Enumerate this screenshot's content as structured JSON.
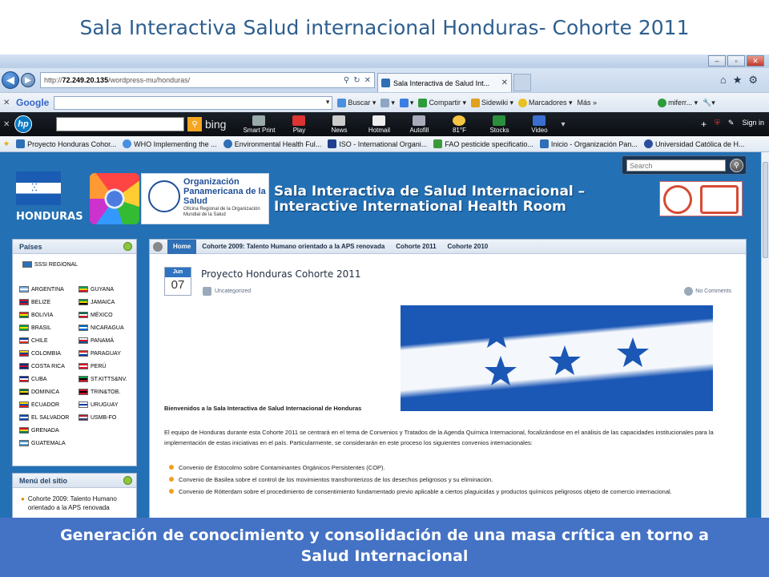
{
  "slide": {
    "title": "Sala Interactiva Salud internacional Honduras- Cohorte 2011",
    "footer_line1": "Generación de conocimiento y consolidación de una masa crítica en torno a",
    "footer_line2": "Salud Internacional"
  },
  "browser": {
    "url_prefix": "http://",
    "url_host": "72.249.20.135",
    "url_path": "/wordpress-mu/honduras/",
    "tab_title": "Sala Interactiva de Salud Int...",
    "window_buttons": [
      "–",
      "▫",
      "✕"
    ]
  },
  "google_bar": {
    "logo": "Google",
    "items": [
      "Buscar ▾",
      "Compartir ▾",
      "Sidewiki ▾",
      "Marcadores ▾",
      "Más »",
      "miferr... ▾"
    ]
  },
  "hp_bar": {
    "logo": "hp",
    "bing": "bing",
    "buttons": [
      "Smart Print",
      "Play",
      "News",
      "Hotmail",
      "Autofill",
      "81°F",
      "Stocks",
      "Video"
    ],
    "signin": "Sign in"
  },
  "favorites": [
    "Proyecto Honduras Cohor...",
    "WHO  Implementing the ...",
    "Environmental Health  Ful...",
    "ISO - International Organi...",
    "FAO pesticide specificatio...",
    "Inicio - Organización Pan...",
    "Universidad Católica de H..."
  ],
  "site": {
    "search_placeholder": "Search",
    "country_label": "HONDURAS",
    "ops_title": "Organización Panamericana de la Salud",
    "ops_sub": "Oficina Regional de la Organización Mundial de la Salud",
    "banner_line1": "Sala Interactiva de Salud Internacional –",
    "banner_line2": "Interactive International Health Room"
  },
  "sidebar": {
    "paises_title": "Países",
    "regional": "SSSI REGIONAL",
    "countries": [
      {
        "name": "ARGENTINA",
        "colors": [
          "#74acdf",
          "#ffffff",
          "#74acdf"
        ]
      },
      {
        "name": "GUYANA",
        "colors": [
          "#009e49",
          "#fcd116",
          "#ce1126"
        ]
      },
      {
        "name": "BELIZE",
        "colors": [
          "#ce1126",
          "#003f87",
          "#ce1126"
        ]
      },
      {
        "name": "JAMAICA",
        "colors": [
          "#009b3a",
          "#fed100",
          "#000000"
        ]
      },
      {
        "name": "BOLIVIA",
        "colors": [
          "#d52b1e",
          "#f9e300",
          "#007934"
        ]
      },
      {
        "name": "MÉXICO",
        "colors": [
          "#006847",
          "#ffffff",
          "#ce1126"
        ]
      },
      {
        "name": "BRASIL",
        "colors": [
          "#009c3b",
          "#ffdf00",
          "#009c3b"
        ]
      },
      {
        "name": "NICARAGUA",
        "colors": [
          "#0067c6",
          "#ffffff",
          "#0067c6"
        ]
      },
      {
        "name": "CHILE",
        "colors": [
          "#0039a6",
          "#ffffff",
          "#d52b1e"
        ]
      },
      {
        "name": "PANAMÁ",
        "colors": [
          "#ffffff",
          "#d21034",
          "#005293"
        ]
      },
      {
        "name": "COLOMBIA",
        "colors": [
          "#fcd116",
          "#003893",
          "#ce1126"
        ]
      },
      {
        "name": "PARAGUAY",
        "colors": [
          "#d52b1e",
          "#ffffff",
          "#0038a8"
        ]
      },
      {
        "name": "COSTA RICA",
        "colors": [
          "#002b7f",
          "#ce1126",
          "#002b7f"
        ]
      },
      {
        "name": "PERÚ",
        "colors": [
          "#d91023",
          "#ffffff",
          "#d91023"
        ]
      },
      {
        "name": "CUBA",
        "colors": [
          "#002a8f",
          "#ffffff",
          "#cf142b"
        ]
      },
      {
        "name": "ST.KITTS&NV.",
        "colors": [
          "#009e49",
          "#000000",
          "#ce1126"
        ]
      },
      {
        "name": "DOMINICA",
        "colors": [
          "#006b3f",
          "#fcd116",
          "#000000"
        ]
      },
      {
        "name": "TRIN&TOB.",
        "colors": [
          "#ce1126",
          "#000000",
          "#ce1126"
        ]
      },
      {
        "name": "ECUADOR",
        "colors": [
          "#ffdd00",
          "#034ea2",
          "#ed1c24"
        ]
      },
      {
        "name": "URUGUAY",
        "colors": [
          "#ffffff",
          "#0038a8",
          "#ffffff"
        ]
      },
      {
        "name": "EL SALVADOR",
        "colors": [
          "#0f47af",
          "#ffffff",
          "#0f47af"
        ]
      },
      {
        "name": "USMB-FO",
        "colors": [
          "#b22234",
          "#ffffff",
          "#3c3b6e"
        ]
      },
      {
        "name": "GRENADA",
        "colors": [
          "#ce1126",
          "#fcd116",
          "#007a5e"
        ]
      },
      {
        "name": "",
        "colors": []
      },
      {
        "name": "GUATEMALA",
        "colors": [
          "#4997d0",
          "#ffffff",
          "#4997d0"
        ]
      }
    ],
    "menu_title": "Menú del sitio",
    "menu_item": "Cohorte 2009: Talento Humano orientado a la APS renovada"
  },
  "main": {
    "nav": [
      "Home",
      "Cohorte 2009: Talento Humano orientado a la APS renovada",
      "Cohorte 2011",
      "Cohorte 2010"
    ],
    "cal_month": "Jun",
    "cal_day": "07",
    "post_title": "Proyecto Honduras Cohorte 2011",
    "category": "Uncategorized",
    "comments": "No Comments",
    "welcome": "Bienvenidos a la Sala Interactiva de Salud Internacional de Honduras",
    "body": "El equipo de Honduras durante esta Cohorte 2011 se centrará en el tema de Convenios y Tratados de la Agenda Química Internacional, focalizándose en el análisis de las capacidades institucionales para la implementación de estas iniciativas en el país.  Particularmente, se considerarán en este proceso los siguientes convenios internacionales:",
    "bullets": [
      "Convenio de Estocolmo sobre Contaminantes Orgánicos Persistentes (COP).",
      "Convenio de Basilea sobre el control de los movimientos transfronterizos de los desechos peligrosos y su eliminación.",
      "Convenio de Rótterdam sobre el procedimiento de consentimiento fundamentado previo aplicable a ciertos plaguicidas y productos químicos peligrosos objeto de comercio internacional."
    ]
  }
}
